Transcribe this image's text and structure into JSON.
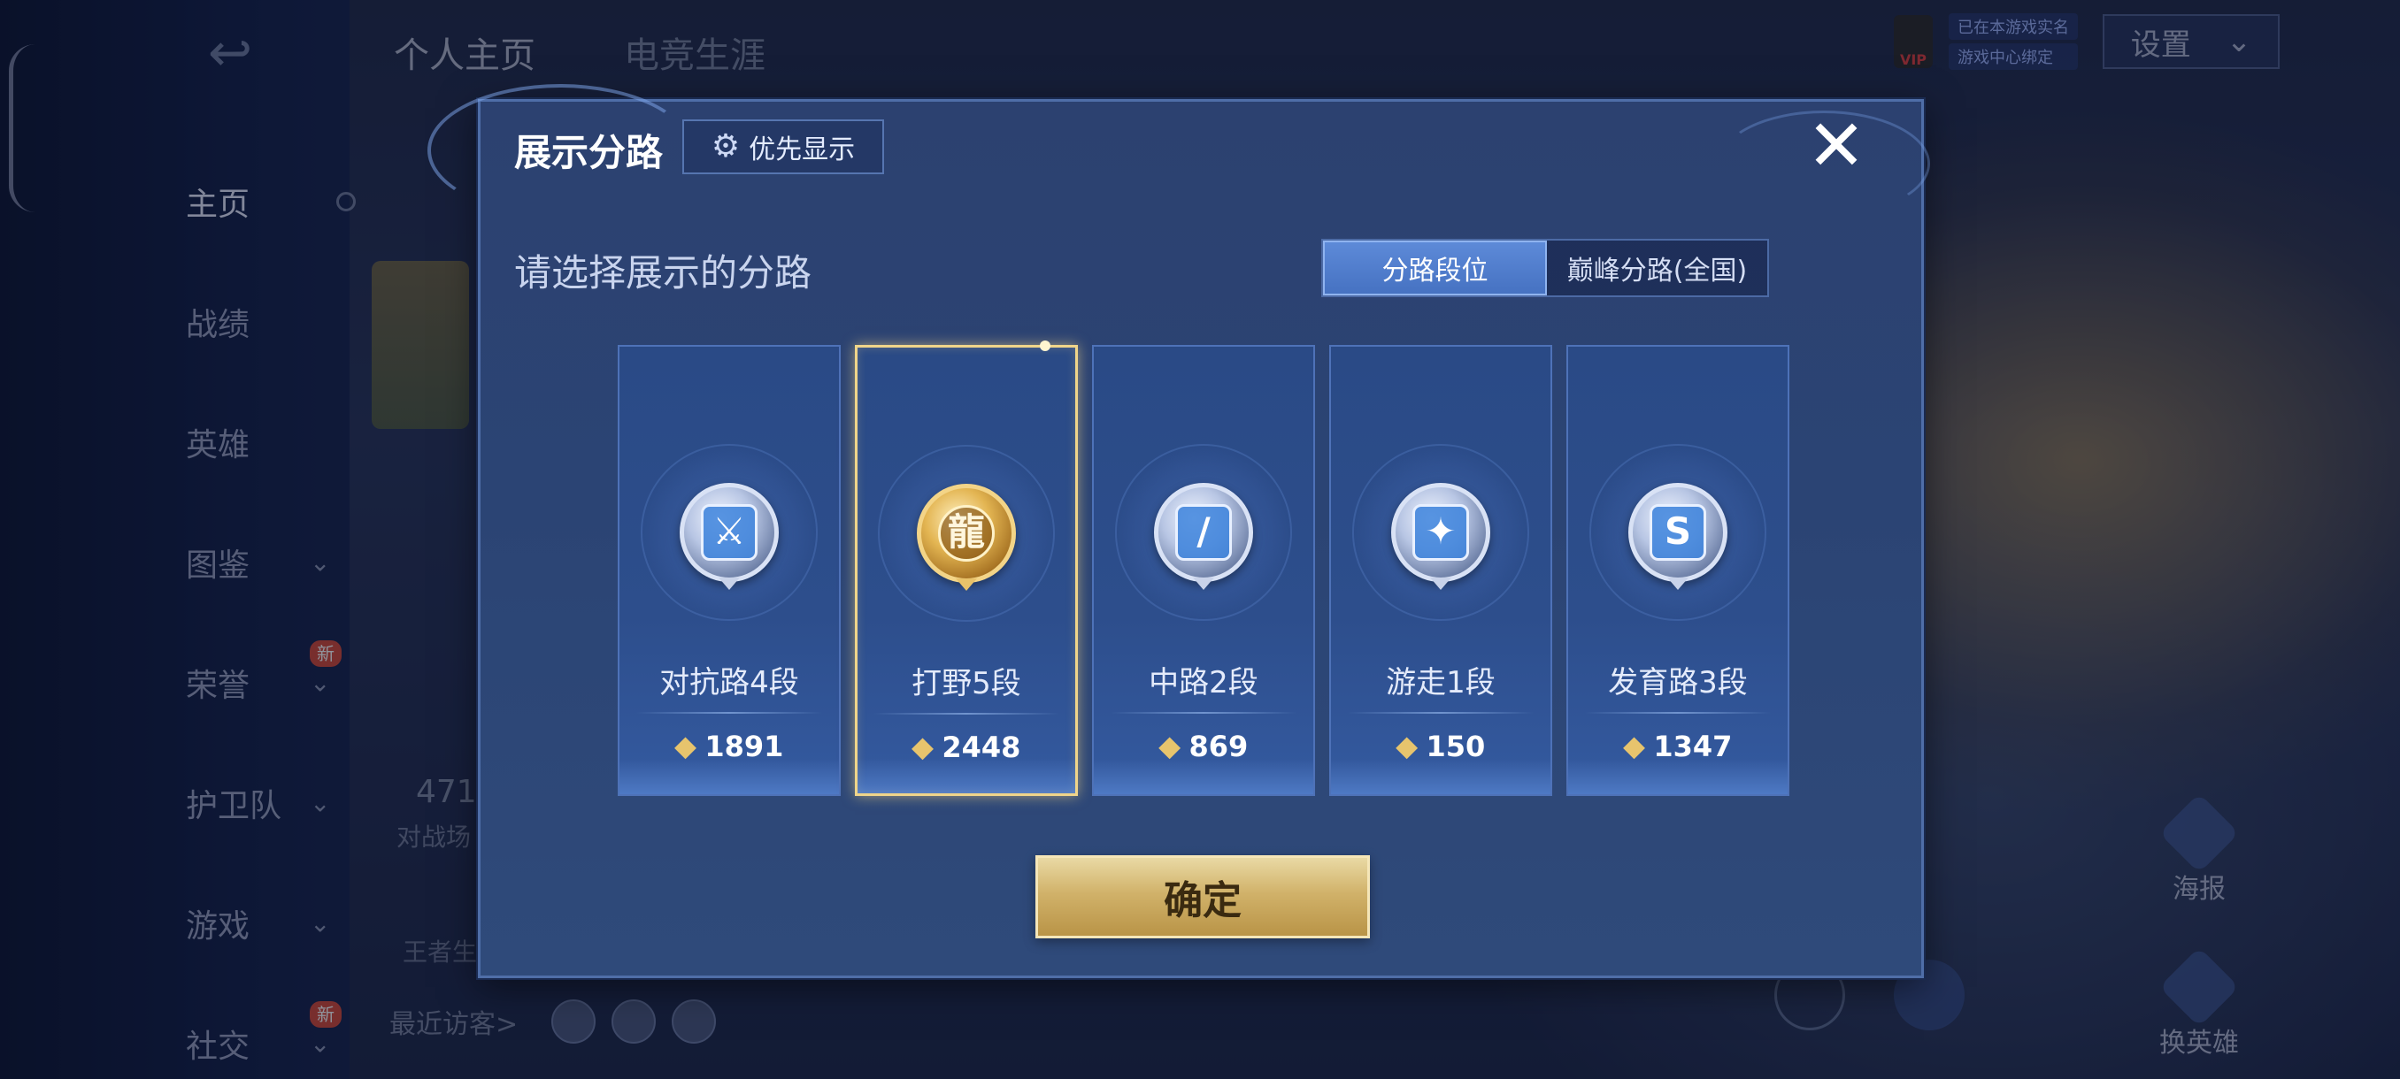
{
  "background": {
    "nav_items": [
      {
        "label": "主页",
        "chevron": false,
        "new": false,
        "active": true
      },
      {
        "label": "战绩",
        "chevron": false,
        "new": false,
        "active": false
      },
      {
        "label": "英雄",
        "chevron": false,
        "new": false,
        "active": false
      },
      {
        "label": "图鉴",
        "chevron": true,
        "new": false,
        "active": false
      },
      {
        "label": "荣誉",
        "chevron": true,
        "new": true,
        "active": false
      },
      {
        "label": "护卫队",
        "chevron": true,
        "new": false,
        "active": false
      },
      {
        "label": "游戏",
        "chevron": true,
        "new": false,
        "active": false
      },
      {
        "label": "社交",
        "chevron": true,
        "new": true,
        "active": false
      }
    ],
    "new_badge": "新",
    "tabs": [
      "个人主页",
      "电竞生涯"
    ],
    "stat_number": "471",
    "stat_label": "对战场",
    "wz_label": "王者生",
    "recent_visitors_label": "最近访客>",
    "realname_lines": [
      "已在本游戏实名",
      "游戏中心绑定"
    ],
    "vip_label": "VIP",
    "settings_label": "设置",
    "right_actions": [
      "海报",
      "换英雄"
    ]
  },
  "modal": {
    "title": "展示分路",
    "priority_button": "优先显示",
    "subtitle": "请选择展示的分路",
    "toggle_options": [
      {
        "label": "分路段位",
        "active": true
      },
      {
        "label": "巅峰分路(全国)",
        "active": false
      }
    ],
    "lanes": [
      {
        "label": "对抗路4段",
        "score": "1891",
        "icon": "sword-clash-icon",
        "glyph": "⚔",
        "selected": false,
        "gold": false
      },
      {
        "label": "打野5段",
        "score": "2448",
        "icon": "dragon-icon",
        "glyph": "龍",
        "selected": true,
        "gold": true
      },
      {
        "label": "中路2段",
        "score": "869",
        "icon": "slash-icon",
        "glyph": "/",
        "selected": false,
        "gold": false
      },
      {
        "label": "游走1段",
        "score": "150",
        "icon": "wings-icon",
        "glyph": "✦",
        "selected": false,
        "gold": false
      },
      {
        "label": "发育路3段",
        "score": "1347",
        "icon": "arrow-cycle-icon",
        "glyph": "S",
        "selected": false,
        "gold": false
      }
    ],
    "confirm_label": "确定",
    "close_glyph": "✕",
    "gear_glyph": "⚙",
    "score_glyph": "⬥"
  },
  "colors": {
    "modal_bg": "#2c4170",
    "selected_border": "#f0d58a",
    "toggle_active": "#4f7cc9",
    "confirm_gold": "#d1b26a"
  }
}
